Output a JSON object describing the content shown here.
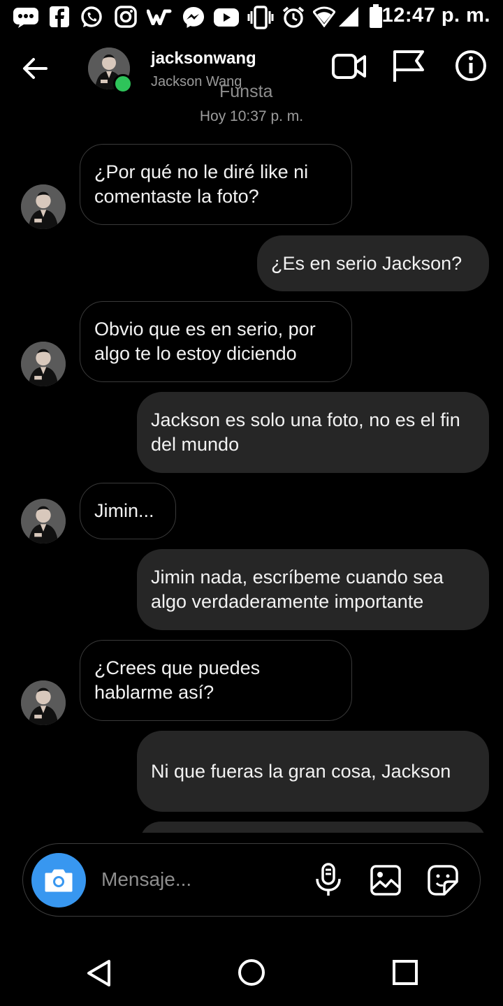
{
  "status_bar": {
    "time": "12:47 p. m.",
    "icons": [
      "message-icon",
      "facebook-icon",
      "whatsapp-icon",
      "instagram-icon",
      "wattpad-icon",
      "messenger-icon",
      "youtube-icon",
      "vibrate-icon",
      "alarm-icon",
      "wifi-icon",
      "signal-icon",
      "battery-icon"
    ]
  },
  "header": {
    "username": "jacksonwang",
    "full_name": "Jackson Wang",
    "account_tag": "Funsta",
    "online": true,
    "icons": [
      "back-arrow-icon",
      "video-call-icon",
      "flag-icon",
      "info-icon"
    ]
  },
  "conversation": {
    "timestamp": "Hoy 10:37 p. m.",
    "messages": [
      {
        "from": "them",
        "text": "¿Por qué no le diré like ni comentaste la foto?"
      },
      {
        "from": "me",
        "text": "¿Es en serio Jackson?"
      },
      {
        "from": "them",
        "text": "Obvio que es en serio, por algo te lo estoy diciendo"
      },
      {
        "from": "me",
        "text": "Jackson es solo una foto, no es el fin del mundo"
      },
      {
        "from": "them",
        "text": "Jimin..."
      },
      {
        "from": "me",
        "text": "Jimin nada, escríbeme cuando sea algo verdaderamente importante"
      },
      {
        "from": "them",
        "text": "¿Crees que puedes hablarme así?"
      },
      {
        "from": "me",
        "text": "Ni que fueras la gran cosa, Jackson"
      }
    ]
  },
  "composer": {
    "placeholder": "Mensaje...",
    "icons": [
      "camera-icon",
      "microphone-icon",
      "gallery-icon",
      "sticker-icon"
    ]
  },
  "nav_bar": {
    "icons": [
      "nav-back-icon",
      "nav-home-icon",
      "nav-recents-icon"
    ]
  },
  "colors": {
    "background": "#000000",
    "outgoing_bubble": "#262626",
    "incoming_border": "#3a3a3a",
    "accent": "#3897f0",
    "online": "#2ec45a"
  }
}
